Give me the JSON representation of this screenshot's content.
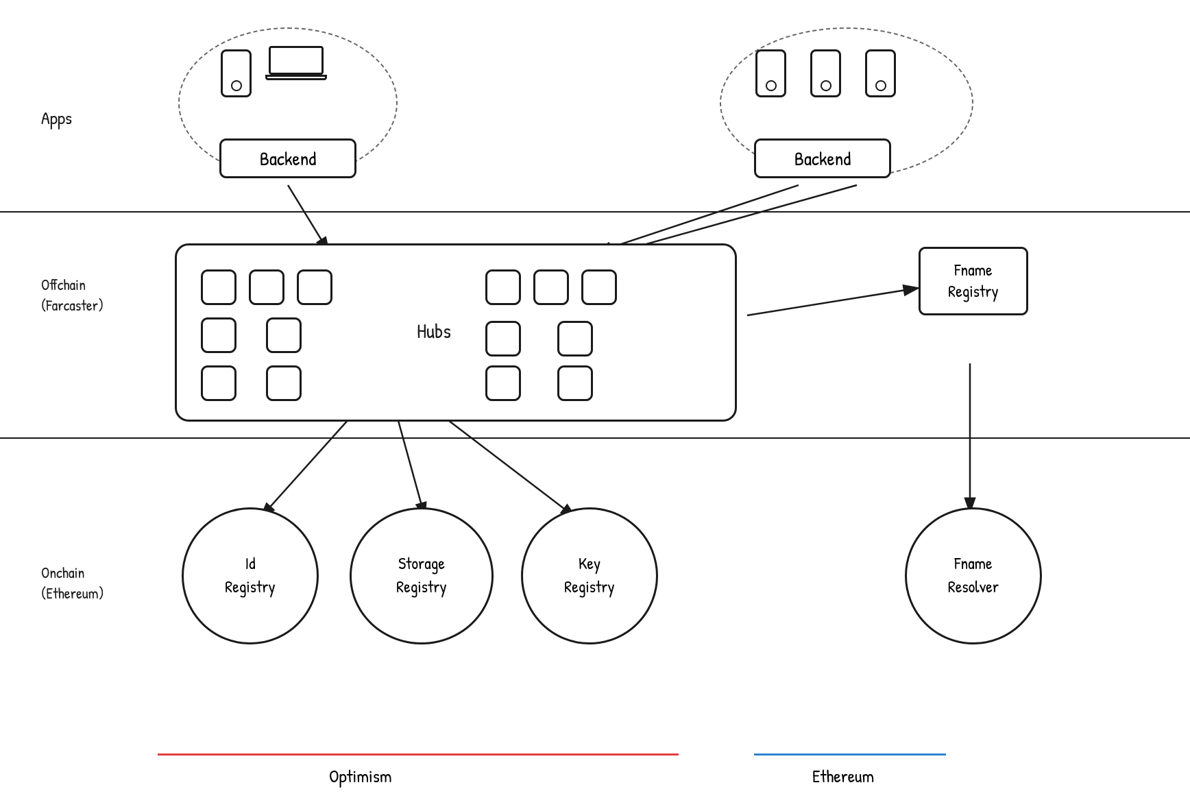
{
  "layers": {
    "apps_label": "Apps",
    "offchain_label": "Offchain",
    "offchain_sub": "(Farcaster)",
    "onchain_label": "Onchain",
    "onchain_sub": "(Ethereum)"
  },
  "components": {
    "backend_left": "Backend",
    "backend_right": "Backend",
    "hubs": "Hubs",
    "fname_registry": "Fname\nRegistry",
    "id_registry": "Id\nRegistry",
    "storage_registry": "Storage\nRegistry",
    "key_registry": "Key\nRegistry",
    "fname_resolver": "Fname\nResolver"
  },
  "networks": {
    "optimism_label": "Optimism",
    "ethereum_label": "Ethereum"
  }
}
